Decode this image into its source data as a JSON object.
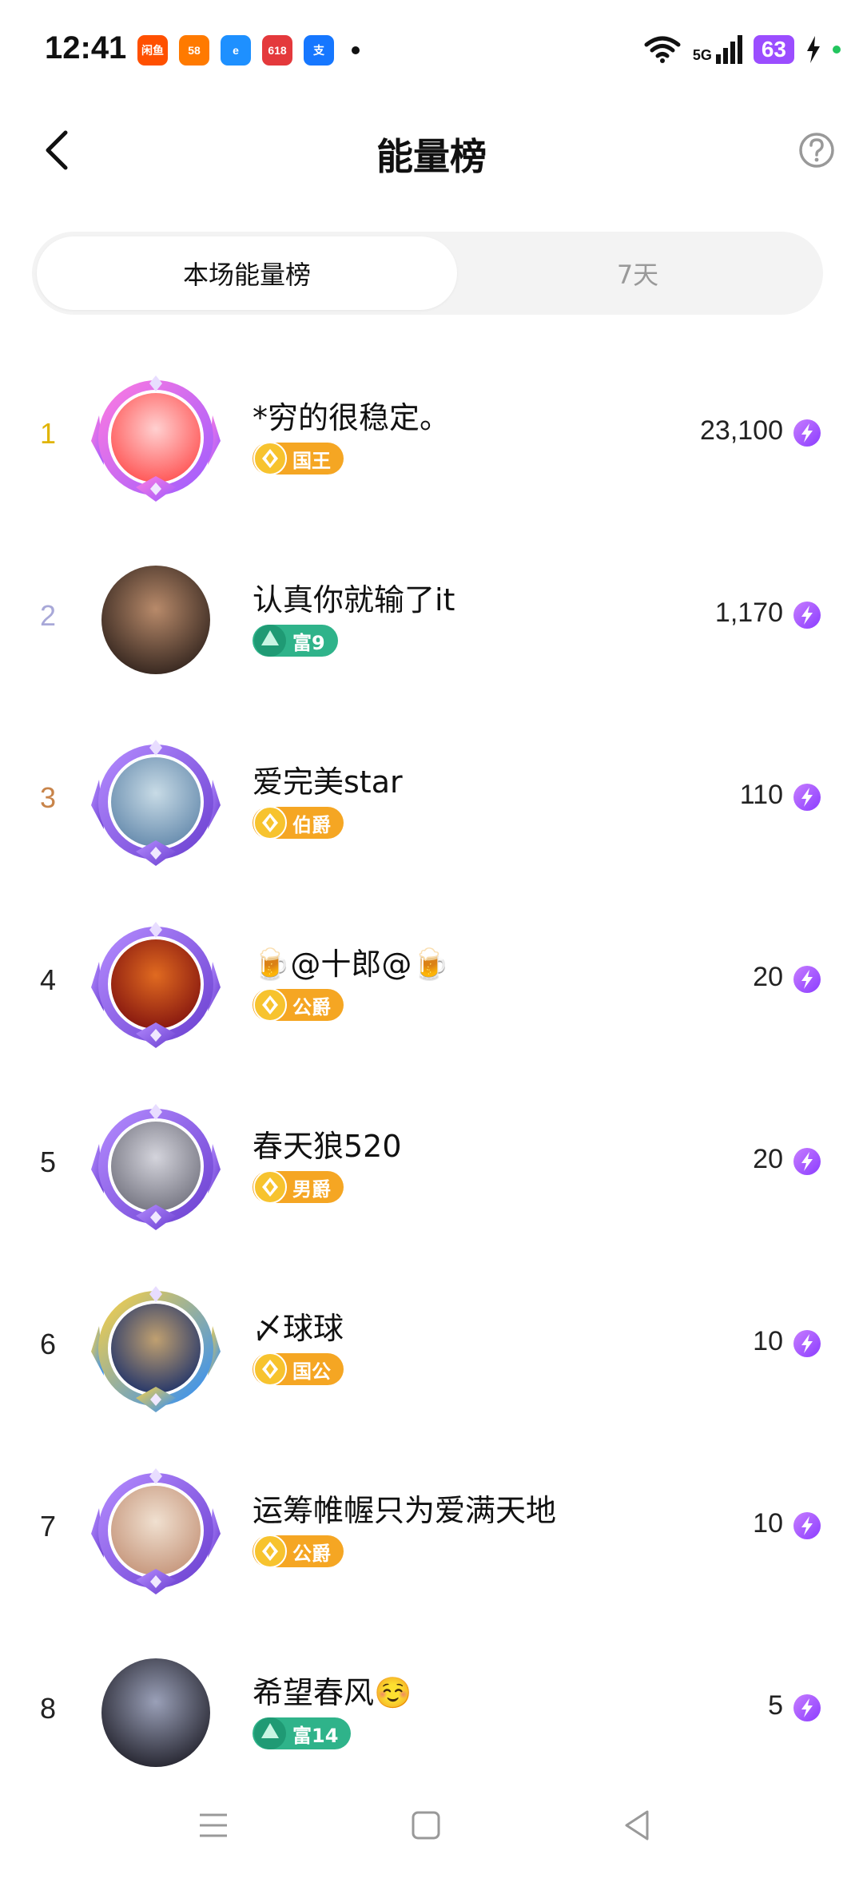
{
  "status_bar": {
    "time": "12:41",
    "app_icons": [
      {
        "name": "taobao-icon",
        "label": "闲鱼",
        "color": "#ff5000"
      },
      {
        "name": "58-icon",
        "label": "58",
        "color": "#ff7a00"
      },
      {
        "name": "eleme-icon",
        "label": "e",
        "color": "#1e90ff"
      },
      {
        "name": "jd-icon",
        "label": "618",
        "color": "#e4393c"
      },
      {
        "name": "alipay-icon",
        "label": "支",
        "color": "#1677ff"
      }
    ],
    "network": "5G",
    "battery": "63",
    "accent_battery": "#9b4dff"
  },
  "header": {
    "title": "能量榜",
    "back_icon": "chevron-left-icon",
    "help_icon": "question-circle-icon"
  },
  "tabs": [
    {
      "label": "本场能量榜",
      "active": true
    },
    {
      "label": "7天",
      "active": false
    }
  ],
  "rankings": [
    {
      "rank": "1",
      "rank_color": "#e0b400",
      "name": "*穷的很稳定。",
      "badge": "国王",
      "badge_type": "noble",
      "score": "23,100",
      "avatar_frame": "red"
    },
    {
      "rank": "2",
      "rank_color": "#a8a8d8",
      "name": "认真你就输了it",
      "badge": "富9",
      "badge_type": "wealth",
      "score": "1,170",
      "avatar_frame": "none"
    },
    {
      "rank": "3",
      "rank_color": "#c8844a",
      "name": "爱完美star",
      "badge": "伯爵",
      "badge_type": "noble",
      "score": "110",
      "avatar_frame": "purple"
    },
    {
      "rank": "4",
      "rank_color": "#222222",
      "name": "🍺@十郎@🍺",
      "badge": "公爵",
      "badge_type": "noble",
      "score": "20",
      "avatar_frame": "purple"
    },
    {
      "rank": "5",
      "rank_color": "#222222",
      "name": "春天狼520",
      "badge": "男爵",
      "badge_type": "noble",
      "score": "20",
      "avatar_frame": "purple"
    },
    {
      "rank": "6",
      "rank_color": "#222222",
      "name": "〆球球",
      "badge": "国公",
      "badge_type": "noble",
      "score": "10",
      "avatar_frame": "blue"
    },
    {
      "rank": "7",
      "rank_color": "#222222",
      "name": "运筹帷幄只为爱满天地",
      "badge": "公爵",
      "badge_type": "noble",
      "score": "10",
      "avatar_frame": "purple"
    },
    {
      "rank": "8",
      "rank_color": "#222222",
      "name": "希望春风☺️",
      "badge": "富14",
      "badge_type": "wealth",
      "score": "5",
      "avatar_frame": "none"
    }
  ],
  "colors": {
    "noble_badge": "#f5a623",
    "wealth_badge": "#2fb38a",
    "energy": "#8b3dff"
  },
  "navbar": {
    "menu_icon": "menu-icon",
    "home_icon": "home-square-icon",
    "back_icon": "back-triangle-icon"
  }
}
